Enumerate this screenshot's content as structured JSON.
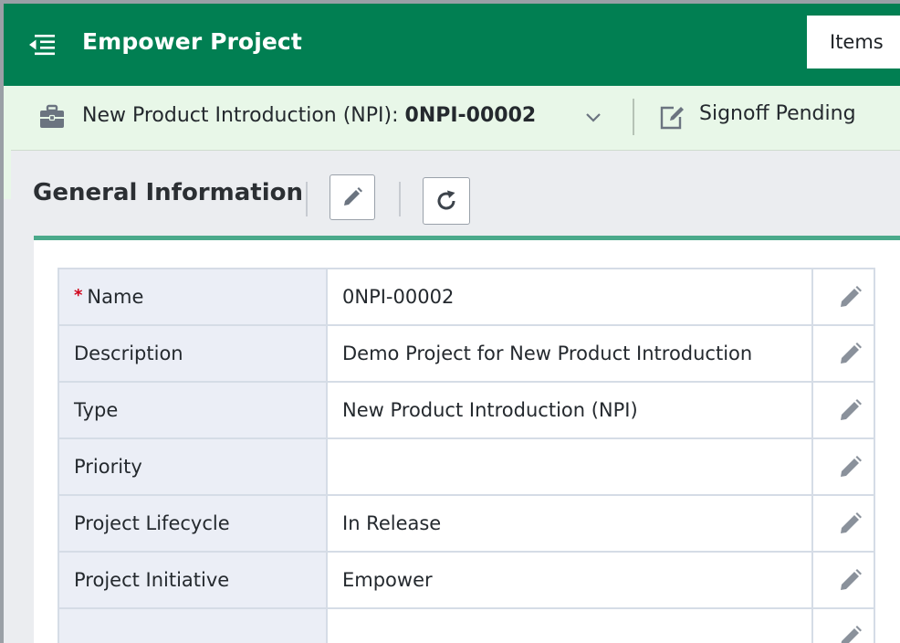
{
  "header": {
    "title": "Empower Project",
    "menu_icon": "menu-collapse-icon",
    "tab_label": "Items"
  },
  "context": {
    "object_type": "New Product Introduction (NPI):",
    "object_id": "0NPI-00002",
    "status": "Signoff Pending",
    "icons": [
      "briefcase-icon",
      "chevron-down-icon",
      "edit-document-icon"
    ]
  },
  "section": {
    "title": "General Information",
    "actions": [
      "edit-icon",
      "refresh-icon"
    ]
  },
  "properties": [
    {
      "label": "Name",
      "required": true,
      "value": "0NPI-00002"
    },
    {
      "label": "Description",
      "required": false,
      "value": "Demo Project for New Product Introduction"
    },
    {
      "label": "Type",
      "required": false,
      "value": "New Product Introduction (NPI)"
    },
    {
      "label": "Priority",
      "required": false,
      "value": ""
    },
    {
      "label": "Project Lifecycle",
      "required": false,
      "value": "In Release"
    },
    {
      "label": "Project Initiative",
      "required": false,
      "value": "Empower"
    },
    {
      "label": "",
      "required": false,
      "value": ""
    }
  ],
  "colors": {
    "header_bg": "#017f52",
    "context_bg": "#e8f7e8",
    "panel_accent": "#4aa98a",
    "required": "#d0021b"
  }
}
